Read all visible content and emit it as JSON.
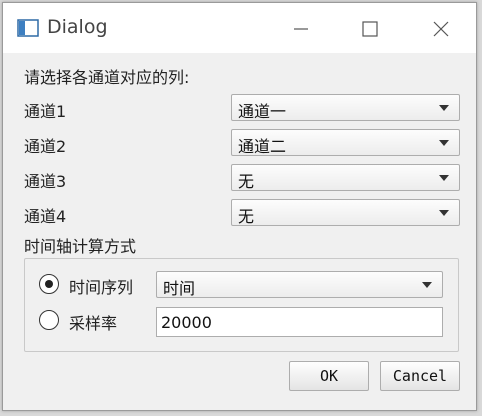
{
  "window": {
    "title": "Dialog"
  },
  "prompt": "请选择各通道对应的列:",
  "channels": [
    {
      "label": "通道1",
      "value": "通道一"
    },
    {
      "label": "通道2",
      "value": "通道二"
    },
    {
      "label": "通道3",
      "value": "无"
    },
    {
      "label": "通道4",
      "value": "无"
    }
  ],
  "time_axis": {
    "heading": "时间轴计算方式",
    "time_series_label": "时间序列",
    "time_series_selected": true,
    "time_column_value": "时间",
    "sample_rate_label": "采样率",
    "sample_rate_selected": false,
    "sample_rate_value": "20000"
  },
  "buttons": {
    "ok": "OK",
    "cancel": "Cancel"
  }
}
